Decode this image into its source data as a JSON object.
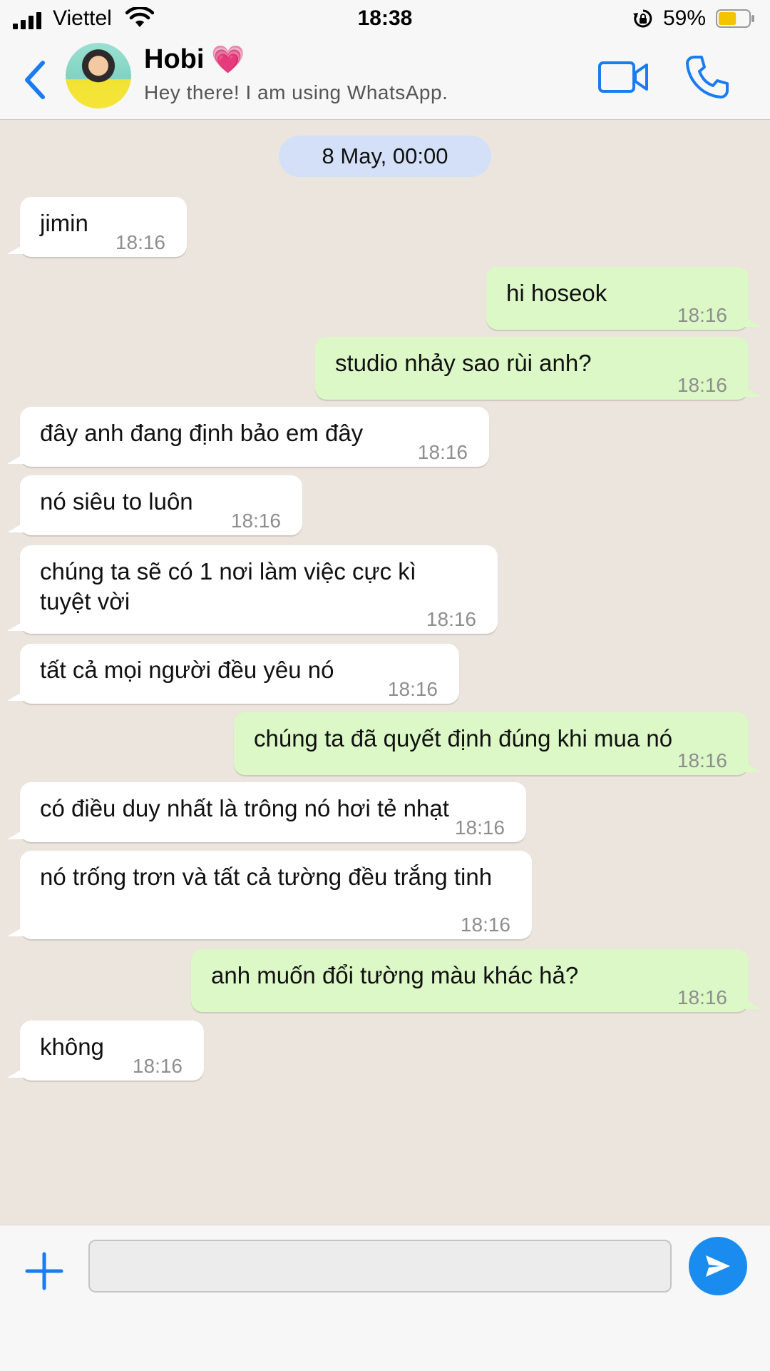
{
  "status_bar": {
    "carrier": "Viettel",
    "time": "18:38",
    "battery_percent": "59%",
    "battery_level": 0.59,
    "icons": [
      "signal-icon",
      "wifi-icon",
      "rotation-lock-icon",
      "battery-icon"
    ]
  },
  "header": {
    "contact_name": "Hobi",
    "heart_emoji": "💗",
    "contact_status": "Hey there! I am using WhatsApp.",
    "icons": [
      "back-icon",
      "video-call-icon",
      "phone-call-icon"
    ]
  },
  "chat": {
    "date_label": "8 May, 00:00",
    "messages": [
      {
        "direction": "in",
        "text": "jimin",
        "time": "18:16"
      },
      {
        "direction": "out",
        "text": "hi hoseok",
        "time": "18:16"
      },
      {
        "direction": "out",
        "text": "studio nhảy sao rùi anh?",
        "time": "18:16"
      },
      {
        "direction": "in",
        "text": "đây anh đang định bảo em đây",
        "time": "18:16"
      },
      {
        "direction": "in",
        "text": "nó siêu to luôn",
        "time": "18:16"
      },
      {
        "direction": "in",
        "text": "chúng ta sẽ có 1 nơi làm việc cực kì tuyệt vời",
        "time": "18:16"
      },
      {
        "direction": "in",
        "text": "tất cả mọi người đều yêu nó",
        "time": "18:16"
      },
      {
        "direction": "out",
        "text": "chúng ta đã quyết định đúng khi mua nó",
        "time": "18:16"
      },
      {
        "direction": "in",
        "text": "có điều duy nhất là trông nó hơi tẻ nhạt",
        "time": "18:16"
      },
      {
        "direction": "in",
        "text": "nó trống trơn và tất cả tường đều trắng tinh",
        "time": "18:16"
      },
      {
        "direction": "out",
        "text": "anh muốn đổi tường màu khác hả?",
        "time": "18:16"
      },
      {
        "direction": "in",
        "text": "không",
        "time": "18:16"
      }
    ]
  },
  "input_bar": {
    "message_value": "",
    "icons": [
      "plus-icon",
      "send-icon"
    ]
  },
  "colors": {
    "accent": "#1a8cf0",
    "outgoing_bubble": "#dcf8c6",
    "incoming_bubble": "#ffffff",
    "chat_background": "#ece5dd",
    "date_pill": "#d4e0f7",
    "battery": "#f5c400"
  }
}
